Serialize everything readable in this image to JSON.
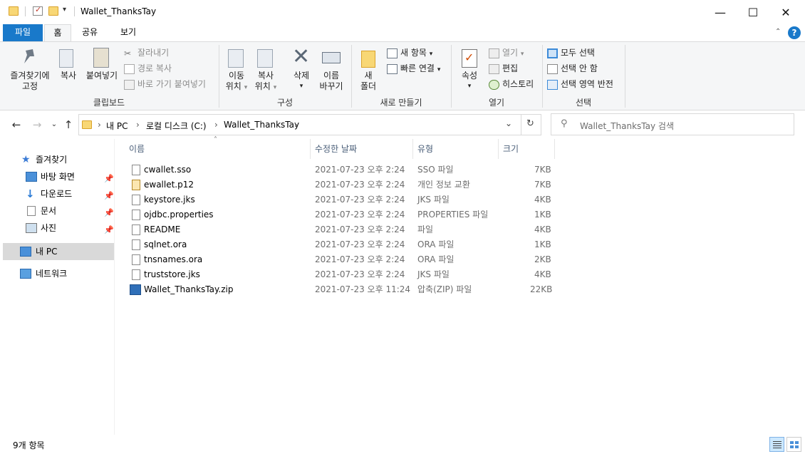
{
  "window": {
    "title": "Wallet_ThanksTay",
    "minimize": "—",
    "maximize": "☐",
    "close": "✕"
  },
  "tabs": [
    {
      "label": "파일",
      "active": true
    },
    {
      "label": "홈",
      "selected": true
    },
    {
      "label": "공유"
    },
    {
      "label": "보기"
    }
  ],
  "ribbon": {
    "clipboard": {
      "pin_label_1": "즐겨찾기에",
      "pin_label_2": "고정",
      "copy": "복사",
      "paste": "붙여넣기",
      "cut": "잘라내기",
      "copy_path": "경로 복사",
      "paste_shortcut": "바로 가기 붙여넣기",
      "group": "클립보드"
    },
    "organize": {
      "move_1": "이동",
      "move_2": "위치",
      "copy_1": "복사",
      "copy_2": "위치",
      "delete": "삭제",
      "rename_1": "이름",
      "rename_2": "바꾸기",
      "group": "구성"
    },
    "new": {
      "new_folder_1": "새",
      "new_folder_2": "폴더",
      "new_item": "새 항목",
      "easy_access": "빠른 연결",
      "group": "새로 만들기"
    },
    "open": {
      "properties": "속성",
      "open": "열기",
      "edit": "편집",
      "history": "히스토리",
      "group": "열기"
    },
    "select": {
      "select_all": "모두 선택",
      "select_none": "선택 안 함",
      "invert": "선택 영역 반전",
      "group": "선택"
    }
  },
  "address": {
    "path": [
      "내 PC",
      "로컬 디스크 (C:)",
      "Wallet_ThanksTay"
    ],
    "search_placeholder": "Wallet_ThanksTay 검색"
  },
  "nav": {
    "quick_access": "즐겨찾기",
    "items": [
      {
        "label": "바탕 화면",
        "icon": "desktop-icon"
      },
      {
        "label": "다운로드",
        "icon": "download-icon"
      },
      {
        "label": "문서",
        "icon": "documents-icon"
      },
      {
        "label": "사진",
        "icon": "pictures-icon"
      }
    ],
    "this_pc": "내 PC",
    "network": "네트워크"
  },
  "columns": {
    "name": "이름",
    "date": "수정한 날짜",
    "type": "유형",
    "size": "크기"
  },
  "files": [
    {
      "name": "cwallet.sso",
      "date": "2021-07-23 오후 2:24",
      "type": "SSO 파일",
      "size": "7KB"
    },
    {
      "name": "ewallet.p12",
      "date": "2021-07-23 오후 2:24",
      "type": "개인 정보 교환",
      "size": "7KB"
    },
    {
      "name": "keystore.jks",
      "date": "2021-07-23 오후 2:24",
      "type": "JKS 파일",
      "size": "4KB"
    },
    {
      "name": "ojdbc.properties",
      "date": "2021-07-23 오후 2:24",
      "type": "PROPERTIES 파일",
      "size": "1KB"
    },
    {
      "name": "README",
      "date": "2021-07-23 오후 2:24",
      "type": "파일",
      "size": "4KB"
    },
    {
      "name": "sqlnet.ora",
      "date": "2021-07-23 오후 2:24",
      "type": "ORA 파일",
      "size": "1KB"
    },
    {
      "name": "tnsnames.ora",
      "date": "2021-07-23 오후 2:24",
      "type": "ORA 파일",
      "size": "2KB"
    },
    {
      "name": "truststore.jks",
      "date": "2021-07-23 오후 2:24",
      "type": "JKS 파일",
      "size": "4KB"
    },
    {
      "name": "Wallet_ThanksTay.zip",
      "date": "2021-07-23 오후 11:24",
      "type": "압축(ZIP) 파일",
      "size": "22KB"
    }
  ],
  "status": {
    "count": "9개 항목"
  },
  "colors": {
    "file_tab": "#1979ca",
    "accent": "#0078d7",
    "selected_nav": "#cce8ff"
  }
}
